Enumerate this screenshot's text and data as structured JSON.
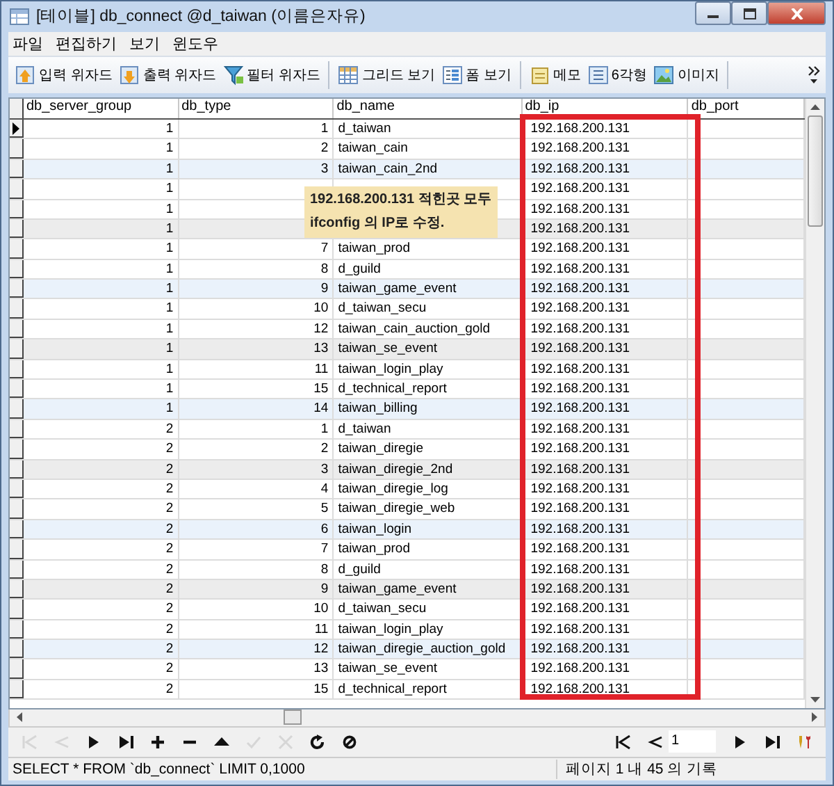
{
  "window": {
    "title": "[테이블] db_connect @d_taiwan (이름은자유)"
  },
  "menu": [
    "파일",
    "편집하기",
    "보기",
    "윈도우"
  ],
  "toolbar": [
    [
      "입력 위자드",
      "출력 위자드",
      "필터 위자드"
    ],
    [
      "그리드 보기",
      "폼 보기"
    ],
    [
      "메모",
      "6각형",
      "이미지"
    ]
  ],
  "table": {
    "columns": [
      "db_server_group",
      "db_type",
      "db_name",
      "db_ip",
      "db_port"
    ],
    "rows": [
      {
        "db_server_group": "1",
        "db_type": "1",
        "db_name": "d_taiwan",
        "db_ip": "192.168.200.131",
        "current": true,
        "kind": "plain"
      },
      {
        "db_server_group": "1",
        "db_type": "2",
        "db_name": "taiwan_cain",
        "db_ip": "192.168.200.131",
        "current": false,
        "kind": "plain"
      },
      {
        "db_server_group": "1",
        "db_type": "3",
        "db_name": "taiwan_cain_2nd",
        "db_ip": "192.168.200.131",
        "current": false,
        "kind": "tinted"
      },
      {
        "db_server_group": "1",
        "db_ip": "192.168.200.131",
        "current": false,
        "kind": "plain"
      },
      {
        "db_server_group": "1",
        "db_ip": "192.168.200.131",
        "current": false,
        "kind": "plain"
      },
      {
        "db_server_group": "1",
        "db_ip": "192.168.200.131",
        "current": false,
        "kind": "shaded"
      },
      {
        "db_server_group": "1",
        "db_type": "7",
        "db_name": "taiwan_prod",
        "db_ip": "192.168.200.131",
        "current": false,
        "kind": "plain"
      },
      {
        "db_server_group": "1",
        "db_type": "8",
        "db_name": "d_guild",
        "db_ip": "192.168.200.131",
        "current": false,
        "kind": "plain"
      },
      {
        "db_server_group": "1",
        "db_type": "9",
        "db_name": "taiwan_game_event",
        "db_ip": "192.168.200.131",
        "current": false,
        "kind": "tinted"
      },
      {
        "db_server_group": "1",
        "db_type": "10",
        "db_name": "d_taiwan_secu",
        "db_ip": "192.168.200.131",
        "current": false,
        "kind": "plain"
      },
      {
        "db_server_group": "1",
        "db_type": "12",
        "db_name": "taiwan_cain_auction_gold",
        "db_ip": "192.168.200.131",
        "current": false,
        "kind": "plain"
      },
      {
        "db_server_group": "1",
        "db_type": "13",
        "db_name": "taiwan_se_event",
        "db_ip": "192.168.200.131",
        "current": false,
        "kind": "shaded"
      },
      {
        "db_server_group": "1",
        "db_type": "11",
        "db_name": "taiwan_login_play",
        "db_ip": "192.168.200.131",
        "current": false,
        "kind": "plain"
      },
      {
        "db_server_group": "1",
        "db_type": "15",
        "db_name": "d_technical_report",
        "db_ip": "192.168.200.131",
        "current": false,
        "kind": "plain"
      },
      {
        "db_server_group": "1",
        "db_type": "14",
        "db_name": "taiwan_billing",
        "db_ip": "192.168.200.131",
        "current": false,
        "kind": "tinted"
      },
      {
        "db_server_group": "2",
        "db_type": "1",
        "db_name": "d_taiwan",
        "db_ip": "192.168.200.131",
        "current": false,
        "kind": "plain"
      },
      {
        "db_server_group": "2",
        "db_type": "2",
        "db_name": "taiwan_diregie",
        "db_ip": "192.168.200.131",
        "current": false,
        "kind": "plain"
      },
      {
        "db_server_group": "2",
        "db_type": "3",
        "db_name": "taiwan_diregie_2nd",
        "db_ip": "192.168.200.131",
        "current": false,
        "kind": "shaded"
      },
      {
        "db_server_group": "2",
        "db_type": "4",
        "db_name": "taiwan_diregie_log",
        "db_ip": "192.168.200.131",
        "current": false,
        "kind": "plain"
      },
      {
        "db_server_group": "2",
        "db_type": "5",
        "db_name": "taiwan_diregie_web",
        "db_ip": "192.168.200.131",
        "current": false,
        "kind": "plain"
      },
      {
        "db_server_group": "2",
        "db_type": "6",
        "db_name": "taiwan_login",
        "db_ip": "192.168.200.131",
        "current": false,
        "kind": "tinted"
      },
      {
        "db_server_group": "2",
        "db_type": "7",
        "db_name": "taiwan_prod",
        "db_ip": "192.168.200.131",
        "current": false,
        "kind": "plain"
      },
      {
        "db_server_group": "2",
        "db_type": "8",
        "db_name": "d_guild",
        "db_ip": "192.168.200.131",
        "current": false,
        "kind": "plain"
      },
      {
        "db_server_group": "2",
        "db_type": "9",
        "db_name": "taiwan_game_event",
        "db_ip": "192.168.200.131",
        "current": false,
        "kind": "shaded"
      },
      {
        "db_server_group": "2",
        "db_type": "10",
        "db_name": "d_taiwan_secu",
        "db_ip": "192.168.200.131",
        "current": false,
        "kind": "plain"
      },
      {
        "db_server_group": "2",
        "db_type": "11",
        "db_name": "taiwan_login_play",
        "db_ip": "192.168.200.131",
        "current": false,
        "kind": "plain"
      },
      {
        "db_server_group": "2",
        "db_type": "12",
        "db_name": "taiwan_diregie_auction_gold",
        "db_ip": "192.168.200.131",
        "current": false,
        "kind": "tinted"
      },
      {
        "db_server_group": "2",
        "db_type": "13",
        "db_name": "taiwan_se_event",
        "db_ip": "192.168.200.131",
        "current": false,
        "kind": "plain"
      },
      {
        "db_server_group": "2",
        "db_type": "15",
        "db_name": "d_technical_report",
        "db_ip": "192.168.200.131",
        "current": false,
        "kind": "plain"
      }
    ]
  },
  "note": {
    "lines": [
      "192.168.200.131 적힌곳 모두",
      "ifconfig 의 IP로 수정."
    ]
  },
  "nav_left": [
    {
      "kind": "first",
      "disabled": true
    },
    {
      "kind": "prev",
      "disabled": true
    },
    {
      "kind": "next",
      "disabled": false
    },
    {
      "kind": "last",
      "disabled": false
    },
    {
      "kind": "add",
      "disabled": false
    },
    {
      "kind": "remove",
      "disabled": false
    },
    {
      "kind": "up",
      "disabled": false
    },
    {
      "kind": "confirm",
      "disabled": true
    },
    {
      "kind": "cancel",
      "disabled": true
    },
    {
      "kind": "refresh",
      "disabled": false
    },
    {
      "kind": "stop",
      "disabled": false
    }
  ],
  "nav_right": {
    "before": [
      {
        "kind": "first",
        "disabled": false
      },
      {
        "kind": "prev",
        "disabled": false
      }
    ],
    "page": "1",
    "after": [
      {
        "kind": "next",
        "disabled": false
      },
      {
        "kind": "last",
        "disabled": false
      },
      {
        "kind": "tools",
        "disabled": false
      }
    ]
  },
  "status_bar": {
    "query": "SELECT * FROM `db_connect` LIMIT 0,1000",
    "records": "페이지 1 내 45 의 기록"
  }
}
